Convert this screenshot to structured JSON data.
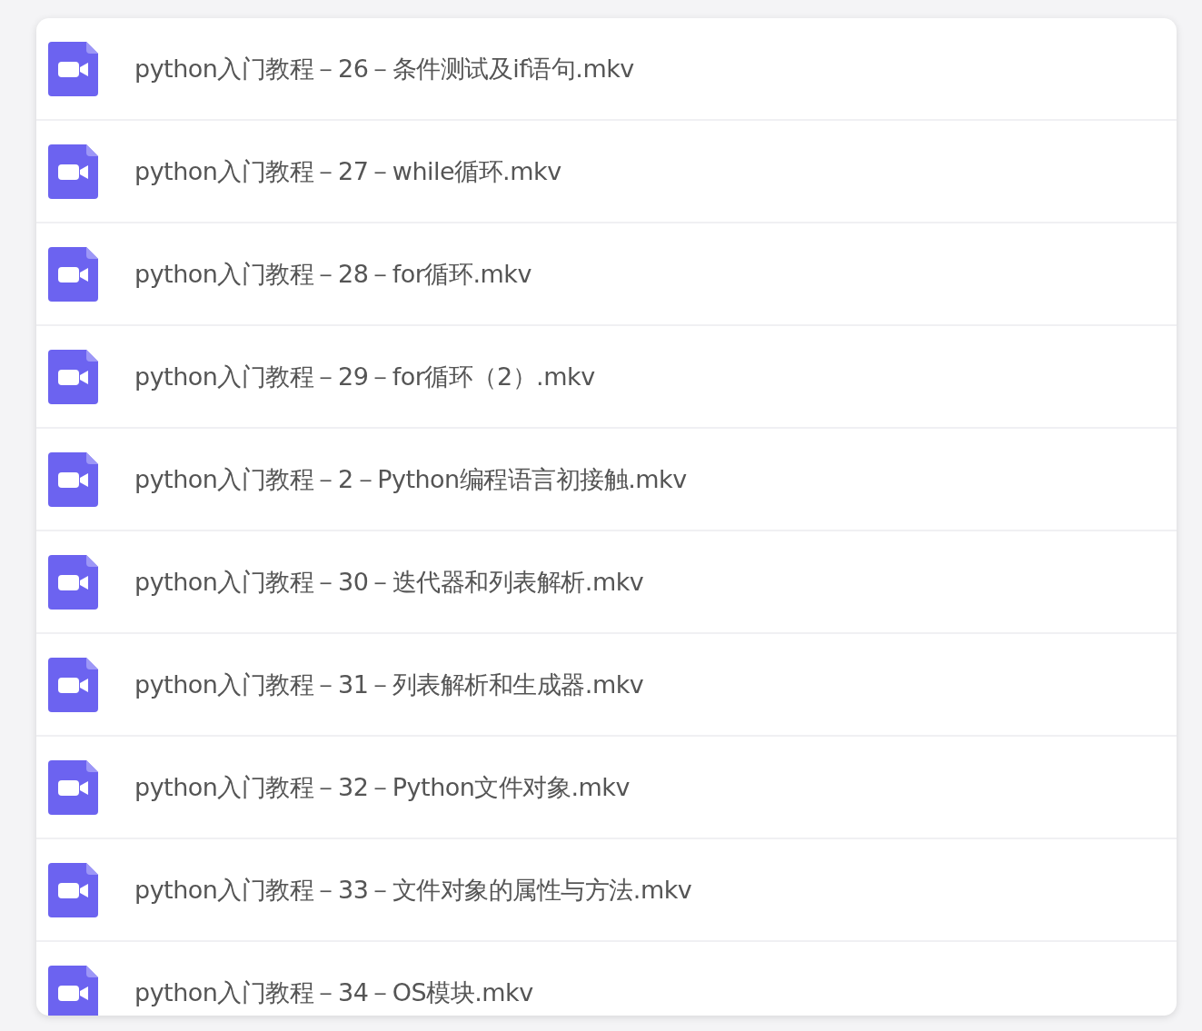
{
  "files": [
    {
      "name": "python入门教程－26－条件测试及if语句.mkv",
      "kind": "video"
    },
    {
      "name": "python入门教程－27－while循环.mkv",
      "kind": "video"
    },
    {
      "name": "python入门教程－28－for循环.mkv",
      "kind": "video"
    },
    {
      "name": "python入门教程－29－for循环（2）.mkv",
      "kind": "video"
    },
    {
      "name": "python入门教程－2－Python编程语言初接触.mkv",
      "kind": "video"
    },
    {
      "name": "python入门教程－30－迭代器和列表解析.mkv",
      "kind": "video"
    },
    {
      "name": "python入门教程－31－列表解析和生成器.mkv",
      "kind": "video"
    },
    {
      "name": "python入门教程－32－Python文件对象.mkv",
      "kind": "video"
    },
    {
      "name": "python入门教程－33－文件对象的属性与方法.mkv",
      "kind": "video"
    },
    {
      "name": "python入门教程－34－OS模块.mkv",
      "kind": "video"
    }
  ]
}
